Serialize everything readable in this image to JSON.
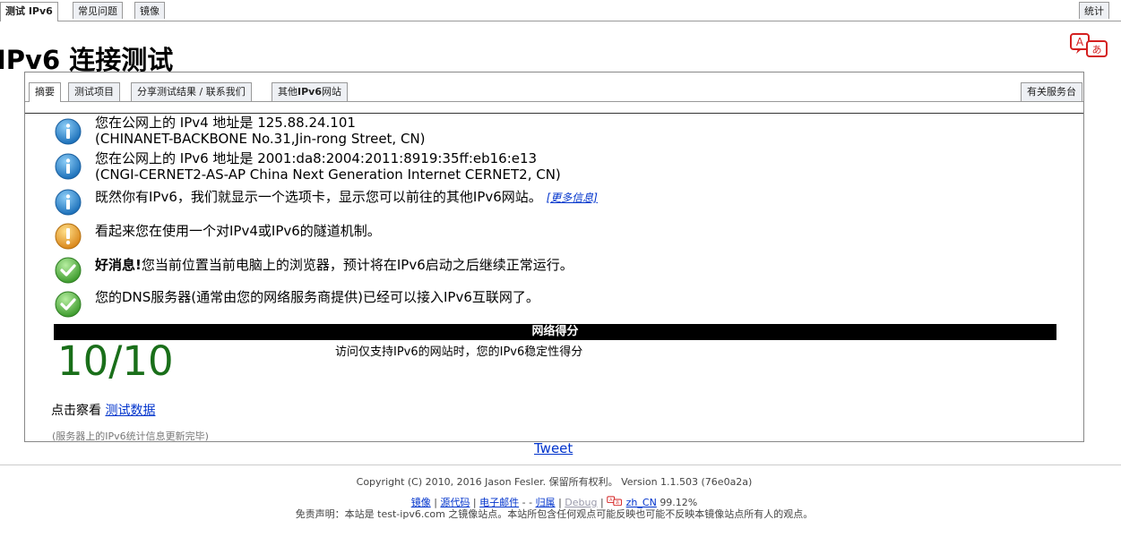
{
  "top_tabs": {
    "test_ipv6": "测试 IPv6",
    "faq": "常见问题",
    "mirrors": "镜像",
    "stats": "统计"
  },
  "page_title": "IPv6 连接测试",
  "inner_tabs": {
    "summary": "摘要",
    "tests_run": "测试项目",
    "share": "分享测试结果 / 联系我们",
    "other_sites_prefix": "其他",
    "other_sites_bold": "IPv6",
    "other_sites_suffix": "网站",
    "for_the_help_desk": "有关服务台"
  },
  "results": [
    {
      "icon": "info-icon",
      "line1": "您在公网上的 IPv4 地址是 125.88.24.101",
      "line2": "(CHINANET-BACKBONE No.31,Jin-rong Street, CN)"
    },
    {
      "icon": "info-icon",
      "line1": "您在公网上的 IPv6 地址是 2001:da8:2004:2011:8919:35ff:eb16:e13",
      "line2": "(CNGI-CERNET2-AS-AP China Next Generation Internet CERNET2, CN)"
    },
    {
      "icon": "info-icon",
      "line1": "既然你有IPv6，我们就显示一个选项卡，显示您可以前往的其他IPv6网站。",
      "link": "[更多信息]"
    },
    {
      "icon": "warning-icon",
      "line1": "看起来您在使用一个对IPv4或IPv6的隧道机制。"
    },
    {
      "icon": "check-icon",
      "bold": "好消息!",
      "line1": "您当前位置当前电脑上的浏览器，预计将在IPv6启动之后继续正常运行。"
    },
    {
      "icon": "check-icon",
      "line1": "您的DNS服务器(通常由您的网络服务商提供)已经可以接入IPv6互联网了。"
    }
  ],
  "score": {
    "header": "网络得分",
    "value": "10/10",
    "description": "访问仅支持IPv6的网站时，您的IPv6稳定性得分"
  },
  "click_data": {
    "prefix": "点击察看",
    "link": "测试数据"
  },
  "server_message": "(服务器上的IPv6统计信息更新完毕)",
  "tweet": "Tweet",
  "footer": {
    "copyright": "Copyright (C) 2010, 2016 Jason Fesler. 保留所有权利。 Version 1.1.503 (76e0a2a)",
    "mirrors": "镜像",
    "source": "源代码",
    "email": "电子邮件",
    "attribution": "归属",
    "debug": "Debug",
    "locale": "zh_CN",
    "locale_pct": "99.12%",
    "disclaimer": "免责声明：本站是 test-ipv6.com 之镜像站点。本站所包含任何观点可能反映也可能不反映本镜像站点所有人的观点。"
  },
  "colors": {
    "info": "#2a8fd6",
    "warning": "#e89a20",
    "ok": "#4fa83a",
    "score": "#1a6f1a",
    "link": "#0033cc"
  }
}
